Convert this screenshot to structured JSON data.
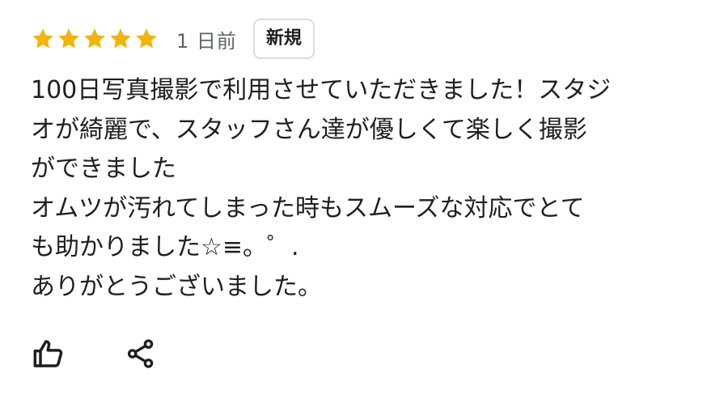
{
  "review": {
    "rating": 5,
    "rating_max": 5,
    "star_color": "#f4b400",
    "date": "1 日前",
    "badge": "新規",
    "text": "100日写真撮影で利用させていただきました！スタジ\nオが綺麗で、スタッフさん達が優しくて楽しく撮影\nができました\nオムツが汚れてしまった時もスムーズな対応でとて\nも助かりました☆≡。゜.\nありがとうございました。"
  },
  "actions": {
    "like_icon": "thumbs-up-icon",
    "share_icon": "share-icon"
  }
}
